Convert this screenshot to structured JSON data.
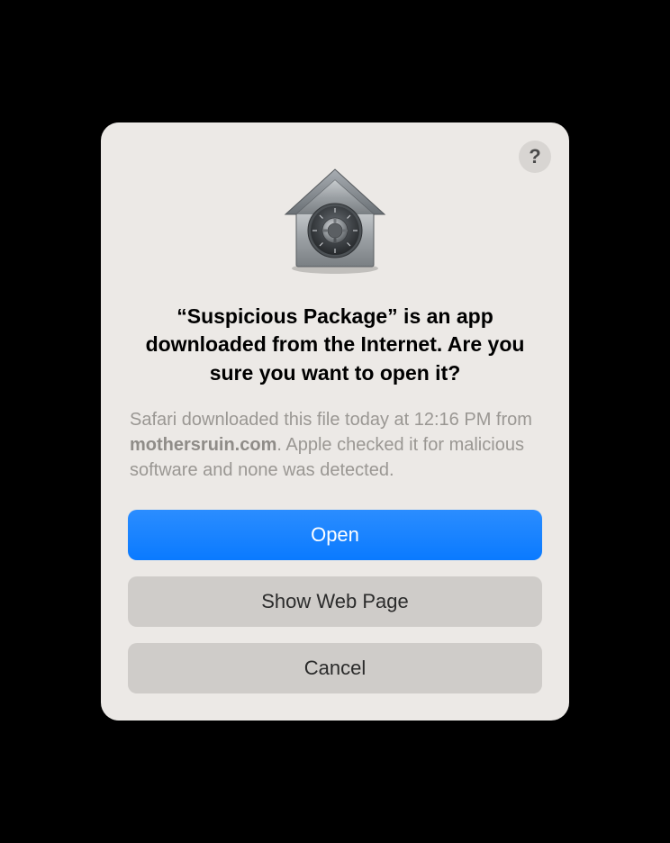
{
  "dialog": {
    "app_name": "Suspicious Package",
    "title": "“Suspicious Package” is an app downloaded from the Internet. Are you sure you want to open it?",
    "subtitle_prefix": "Safari downloaded this file today at 12:16 PM from ",
    "subtitle_domain": "mothersruin.com",
    "subtitle_suffix": ". Apple checked it for malicious software and none was detected.",
    "help_label": "?",
    "buttons": {
      "open": "Open",
      "show_web_page": "Show Web Page",
      "cancel": "Cancel"
    }
  }
}
